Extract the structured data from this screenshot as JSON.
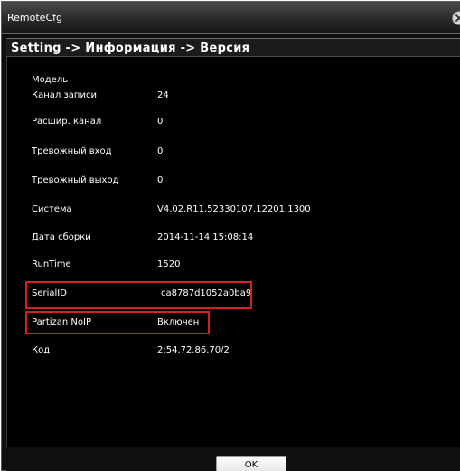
{
  "window": {
    "title": "RemoteCfg"
  },
  "breadcrumb": {
    "text": "Setting -> Информация -> Версия"
  },
  "info": {
    "model_label": "Модель",
    "model_value": "",
    "channel_label": "Канал записи",
    "channel_value": "24",
    "ext_channel_label": "Расшир. канал",
    "ext_channel_value": "0",
    "alarm_in_label": "Тревожный вход",
    "alarm_in_value": "0",
    "alarm_out_label": "Тревожный выход",
    "alarm_out_value": "0",
    "system_label": "Система",
    "system_value": "V4.02.R11.52330107.12201.1300",
    "build_date_label": "Дата сборки",
    "build_date_value": "2014-11-14 15:08:14",
    "runtime_label": "RunTime",
    "runtime_value": "1520",
    "serial_label": "SerialID",
    "serial_value": "ca8787d1052a0ba9",
    "noip_label": "Partizan NoIP",
    "noip_value": "Включен",
    "code_label": "Код",
    "code_value": "2:54.72.86.70/2"
  },
  "footer": {
    "ok_label": "OK"
  },
  "colors": {
    "highlight": "#d42020",
    "background": "#000000",
    "text": "#ffffff"
  },
  "icons": {
    "close": "close-icon"
  }
}
